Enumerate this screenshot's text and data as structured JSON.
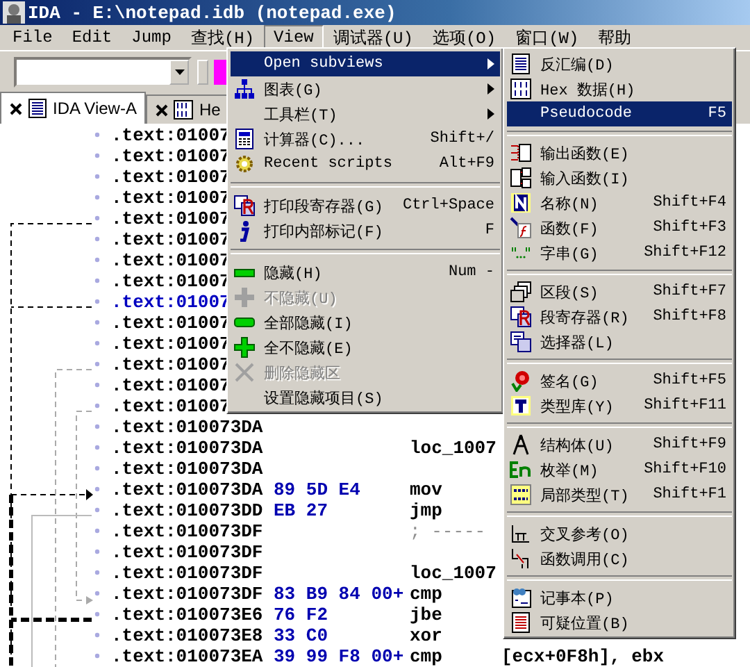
{
  "window": {
    "title": "IDA - E:\\notepad.idb (notepad.exe)"
  },
  "menu_bar": [
    {
      "label": "File",
      "selected": false
    },
    {
      "label": "Edit",
      "selected": false
    },
    {
      "label": "Jump",
      "selected": false
    },
    {
      "label": "查找(H)",
      "selected": false
    },
    {
      "label": "View",
      "selected": true
    },
    {
      "label": "调试器(U)",
      "selected": false
    },
    {
      "label": "选项(O)",
      "selected": false
    },
    {
      "label": "窗口(W)",
      "selected": false
    },
    {
      "label": "帮助",
      "selected": false
    }
  ],
  "tabs": [
    {
      "label": "IDA View-A",
      "selected": true
    },
    {
      "label": "He",
      "selected": false
    }
  ],
  "listing": [
    {
      "address": ".text:01007",
      "selected": false
    },
    {
      "address": ".text:01007",
      "selected": false
    },
    {
      "address": ".text:01007",
      "selected": false
    },
    {
      "address": ".text:01007",
      "selected": false
    },
    {
      "address": ".text:01007",
      "selected": false
    },
    {
      "address": ".text:01007",
      "selected": false
    },
    {
      "address": ".text:01007",
      "selected": false
    },
    {
      "address": ".text:01007",
      "selected": false
    },
    {
      "address": ".text:01007",
      "selected": true
    },
    {
      "address": ".text:01007",
      "selected": false
    },
    {
      "address": ".text:01007",
      "selected": false
    },
    {
      "address": ".text:01007",
      "selected": false
    },
    {
      "address": ".text:01007",
      "selected": false
    },
    {
      "address": ".text:01007",
      "selected": false
    },
    {
      "address": ".text:010073DA",
      "selected": false
    },
    {
      "address": ".text:010073DA",
      "selected": false,
      "label": "loc_1007"
    },
    {
      "address": ".text:010073DA",
      "selected": false
    },
    {
      "address": ".text:010073DA",
      "selected": false,
      "bytes": "89 5D E4",
      "mnemonic": "mov"
    },
    {
      "address": ".text:010073DD",
      "selected": false,
      "bytes": "EB 27",
      "mnemonic": "jmp"
    },
    {
      "address": ".text:010073DF",
      "selected": false,
      "comment": "; -----"
    },
    {
      "address": ".text:010073DF",
      "selected": false
    },
    {
      "address": ".text:010073DF",
      "selected": false,
      "label": "loc_1007"
    },
    {
      "address": ".text:010073DF",
      "selected": false,
      "bytes": "83 B9 84 00+",
      "mnemonic": "cmp"
    },
    {
      "address": ".text:010073E6",
      "selected": false,
      "bytes": "76 F2",
      "mnemonic": "jbe"
    },
    {
      "address": ".text:010073E8",
      "selected": false,
      "bytes": "33 C0",
      "mnemonic": "xor"
    },
    {
      "address": ".text:010073EA",
      "selected": false,
      "bytes": "39 99 F8 00+",
      "mnemonic": "cmp",
      "operand": "[ecx+0F8h], ebx"
    }
  ],
  "view_menu": [
    {
      "kind": "item",
      "label": "Open subviews",
      "selected": true,
      "disabled": false,
      "submenu": true
    },
    {
      "kind": "item",
      "label": "图表(G)",
      "selected": false,
      "disabled": false,
      "submenu": true
    },
    {
      "kind": "item",
      "label": "工具栏(T)",
      "selected": false,
      "disabled": false,
      "submenu": true
    },
    {
      "kind": "item",
      "label": "计算器(C)...",
      "shortcut": "Shift+/",
      "selected": false,
      "disabled": false,
      "submenu": false
    },
    {
      "kind": "item",
      "label": "Recent scripts",
      "shortcut": "Alt+F9",
      "selected": false,
      "disabled": false,
      "submenu": false
    },
    {
      "kind": "separator"
    },
    {
      "kind": "item",
      "label": "打印段寄存器(G)",
      "shortcut": "Ctrl+Space",
      "selected": false,
      "disabled": false,
      "submenu": false
    },
    {
      "kind": "item",
      "label": "打印内部标记(F)",
      "shortcut": "F",
      "selected": false,
      "disabled": false,
      "submenu": false
    },
    {
      "kind": "separator"
    },
    {
      "kind": "item",
      "label": "隐藏(H)",
      "shortcut": "Num -",
      "selected": false,
      "disabled": false,
      "submenu": false
    },
    {
      "kind": "item",
      "label": "不隐藏(U)",
      "selected": false,
      "disabled": true,
      "submenu": false
    },
    {
      "kind": "item",
      "label": "全部隐藏(I)",
      "selected": false,
      "disabled": false,
      "submenu": false
    },
    {
      "kind": "item",
      "label": "全不隐藏(E)",
      "selected": false,
      "disabled": false,
      "submenu": false
    },
    {
      "kind": "item",
      "label": "删除隐藏区",
      "selected": false,
      "disabled": true,
      "submenu": false
    },
    {
      "kind": "item",
      "label": "设置隐藏项目(S)",
      "selected": false,
      "disabled": false,
      "submenu": false
    }
  ],
  "subviews_menu": [
    {
      "kind": "item",
      "label": "反汇编(D)",
      "selected": false
    },
    {
      "kind": "item",
      "label": "Hex 数据(H)",
      "selected": false
    },
    {
      "kind": "item",
      "label": "Pseudocode",
      "shortcut": "F5",
      "selected": true
    },
    {
      "kind": "separator"
    },
    {
      "kind": "item",
      "label": "输出函数(E)",
      "selected": false
    },
    {
      "kind": "item",
      "label": "输入函数(I)",
      "selected": false
    },
    {
      "kind": "item",
      "label": "名称(N)",
      "shortcut": "Shift+F4",
      "selected": false
    },
    {
      "kind": "item",
      "label": "函数(F)",
      "shortcut": "Shift+F3",
      "selected": false
    },
    {
      "kind": "item",
      "label": "字串(G)",
      "shortcut": "Shift+F12",
      "selected": false
    },
    {
      "kind": "separator"
    },
    {
      "kind": "item",
      "label": "区段(S)",
      "shortcut": "Shift+F7",
      "selected": false
    },
    {
      "kind": "item",
      "label": "段寄存器(R)",
      "shortcut": "Shift+F8",
      "selected": false
    },
    {
      "kind": "item",
      "label": "选择器(L)",
      "selected": false
    },
    {
      "kind": "separator"
    },
    {
      "kind": "item",
      "label": "签名(G)",
      "shortcut": "Shift+F5",
      "selected": false
    },
    {
      "kind": "item",
      "label": "类型库(Y)",
      "shortcut": "Shift+F11",
      "selected": false
    },
    {
      "kind": "separator"
    },
    {
      "kind": "item",
      "label": "结构体(U)",
      "shortcut": "Shift+F9",
      "selected": false
    },
    {
      "kind": "item",
      "label": "枚举(M)",
      "shortcut": "Shift+F10",
      "selected": false
    },
    {
      "kind": "item",
      "label": "局部类型(T)",
      "shortcut": "Shift+F1",
      "selected": false
    },
    {
      "kind": "separator"
    },
    {
      "kind": "item",
      "label": "交叉参考(O)",
      "selected": false
    },
    {
      "kind": "item",
      "label": "函数调用(C)",
      "selected": false
    },
    {
      "kind": "separator"
    },
    {
      "kind": "item",
      "label": "记事本(P)",
      "selected": false
    },
    {
      "kind": "item",
      "label": "可疑位置(B)",
      "selected": false
    }
  ]
}
